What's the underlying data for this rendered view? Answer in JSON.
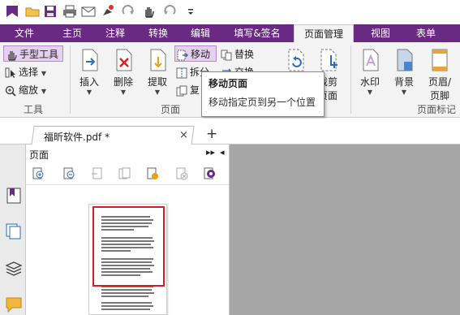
{
  "quick_access": {
    "icons": [
      "fox-logo-icon",
      "open-folder-icon",
      "save-icon",
      "print-icon",
      "email-icon",
      "stamp-icon",
      "redo-icon",
      "hand-tool-icon",
      "undo-icon",
      "customize-icon"
    ]
  },
  "tabs": [
    {
      "label": "文件",
      "active": false
    },
    {
      "label": "主页",
      "active": false
    },
    {
      "label": "注释",
      "active": false
    },
    {
      "label": "转换",
      "active": false
    },
    {
      "label": "编辑",
      "active": false
    },
    {
      "label": "填写&签名",
      "active": false
    },
    {
      "label": "页面管理",
      "active": true
    },
    {
      "label": "视图",
      "active": false
    },
    {
      "label": "表单",
      "active": false
    }
  ],
  "ribbon": {
    "tools_group": {
      "hand_tool": "手型工具",
      "select": "选择",
      "zoom": "缩放",
      "label": "工具"
    },
    "page_group": {
      "insert": "插入",
      "delete": "删除",
      "extract": "提取",
      "move": "移动",
      "split": "拆分",
      "copy_partial": "复",
      "replace": "替换",
      "swap": "交换",
      "crop_line1": "裁剪",
      "crop_line2": "页面",
      "label": "页面"
    },
    "marks_group": {
      "watermark": "水印",
      "background": "背景",
      "header_line1": "页眉/",
      "header_line2": "页脚",
      "label": "页面标记"
    }
  },
  "tooltip": {
    "title": "移动页面",
    "description": "移动指定页到另一个位置"
  },
  "document_tab": {
    "label": "福昕软件.pdf *",
    "close": "×",
    "new_tab": "+"
  },
  "page_panel": {
    "title": "页面",
    "collapse": "▸▸",
    "menu": "◂"
  },
  "colors": {
    "accent": "#6a2a84",
    "selection": "#d21f1f",
    "viewport": "#a6a6a6"
  }
}
